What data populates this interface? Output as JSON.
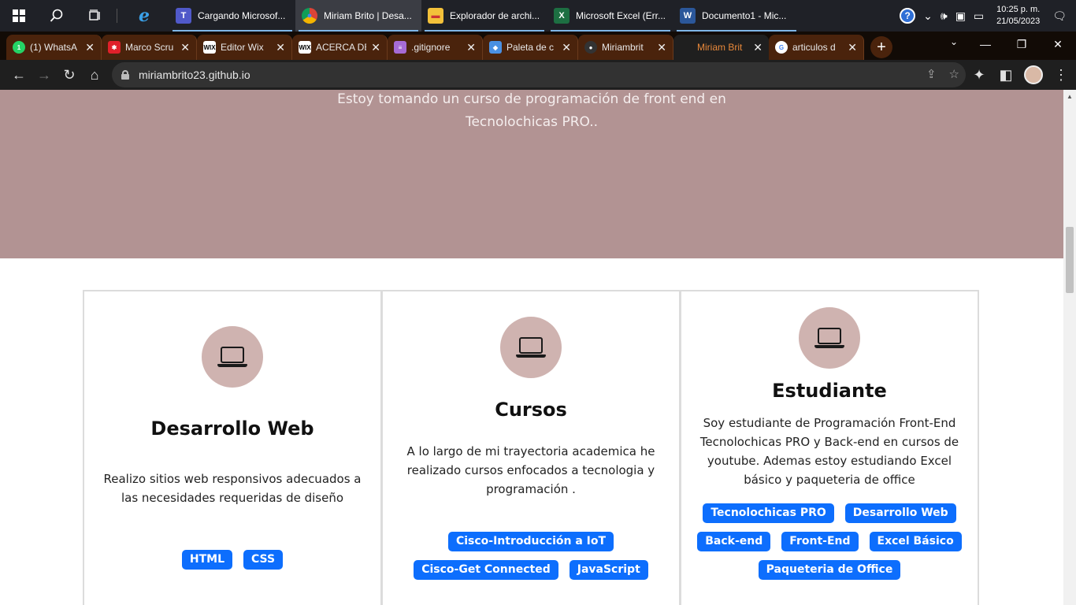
{
  "taskbar": {
    "apps": [
      {
        "label": "Cargando Microsof...",
        "icon": "teams-icon",
        "color": "#5059c9",
        "glyph": "T"
      },
      {
        "label": "Miriam Brito | Desa...",
        "icon": "chrome-icon",
        "color": "#ffffff",
        "glyph": "●"
      },
      {
        "label": "Explorador de archi...",
        "icon": "folder-icon",
        "color": "#f3c13a",
        "glyph": "▬"
      },
      {
        "label": "Microsoft Excel (Err...",
        "icon": "excel-icon",
        "color": "#1d6f42",
        "glyph": "X"
      },
      {
        "label": "Documento1 - Mic...",
        "icon": "word-icon",
        "color": "#2b579a",
        "glyph": "W"
      }
    ],
    "clock_time": "10:25 p. m.",
    "clock_date": "21/05/2023"
  },
  "tabs": [
    {
      "title": "(1) WhatsA",
      "icon": "whatsapp-icon",
      "color": "#25d366",
      "glyph": "1"
    },
    {
      "title": "Marco Scru",
      "icon": "asterisk-icon",
      "color": "#e0202a",
      "glyph": "✱"
    },
    {
      "title": "Editor Wix",
      "icon": "wix-icon",
      "color": "#ffffff",
      "glyph": "WIX"
    },
    {
      "title": "ACERCA DE",
      "icon": "wix-icon",
      "color": "#ffffff",
      "glyph": "WIX"
    },
    {
      "title": ".gitignore",
      "icon": "stack-icon",
      "color": "#a66bd6",
      "glyph": "≡"
    },
    {
      "title": "Paleta de c",
      "icon": "palette-icon",
      "color": "#4a90e2",
      "glyph": "◆"
    },
    {
      "title": "Miriambrit",
      "icon": "github-icon",
      "color": "#333333",
      "glyph": "●"
    },
    {
      "title": "Miriam Brit",
      "icon": "blank-icon",
      "color": "transparent",
      "glyph": ""
    },
    {
      "title": "articulos d",
      "icon": "google-icon",
      "color": "#ffffff",
      "glyph": "G"
    }
  ],
  "address": {
    "url": "miriambrito23.github.io"
  },
  "hero": {
    "text": "Estoy tomando un curso de programación de front end en Tecnolochicas PRO.."
  },
  "cards": [
    {
      "title": "Desarrollo Web",
      "description": "Realizo sitios web responsivos adecuados a las necesidades requeridas de diseño",
      "tags": [
        "HTML",
        "CSS"
      ]
    },
    {
      "title": "Cursos",
      "description": "A lo largo de mi trayectoria academica he realizado cursos enfocados a tecnologia y programación .",
      "tags": [
        "Cisco-Introducción a IoT",
        "Cisco-Get Connected",
        "JavaScript"
      ]
    },
    {
      "title": "Estudiante",
      "description": "Soy estudiante de Programación Front-End Tecnolochicas PRO y Back-end en cursos de youtube. Ademas estoy estudiando Excel básico y paqueteria de office",
      "tags": [
        "Tecnolochicas PRO",
        "Desarrollo Web",
        "Back-end",
        "Front-End",
        "Excel Básico",
        "Paqueteria de Office"
      ]
    }
  ],
  "colors": {
    "hero_bg": "#b29393",
    "icon_circle": "#cfb3b0",
    "tag_bg": "#0d6efd",
    "tab_bg": "#4a230c",
    "active_tab_text": "#e8883a"
  }
}
